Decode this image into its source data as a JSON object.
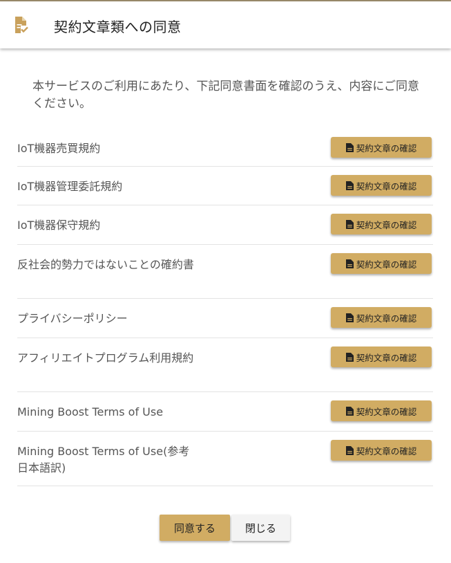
{
  "header": {
    "title": "契約文章類への同意",
    "icon": "document-check-icon"
  },
  "intro": "本サービスのご利用にあたり、下記同意書面を確認のうえ、内容にご同意ください。",
  "colors": {
    "accent": "#d1ac63",
    "icon": "#c9a15c"
  },
  "documents": [
    {
      "label": "IoT機器売買規約",
      "button": "契約文章の確認"
    },
    {
      "label": "IoT機器管理委託規約",
      "button": "契約文章の確認"
    },
    {
      "label": "IoT機器保守規約",
      "button": "契約文章の確認"
    },
    {
      "label": "反社会的勢力ではないことの確約書",
      "button": "契約文章の確認"
    },
    {
      "label": "プライバシーポリシー",
      "button": "契約文章の確認"
    },
    {
      "label": "アフィリエイトプログラム利用規約",
      "button": "契約文章の確認"
    },
    {
      "label": "Mining Boost Terms of Use",
      "button": "契約文章の確認"
    },
    {
      "label": "Mining Boost Terms of Use(参考日本語訳)",
      "button": "契約文章の確認"
    }
  ],
  "footer": {
    "agree": "同意する",
    "close": "閉じる"
  }
}
